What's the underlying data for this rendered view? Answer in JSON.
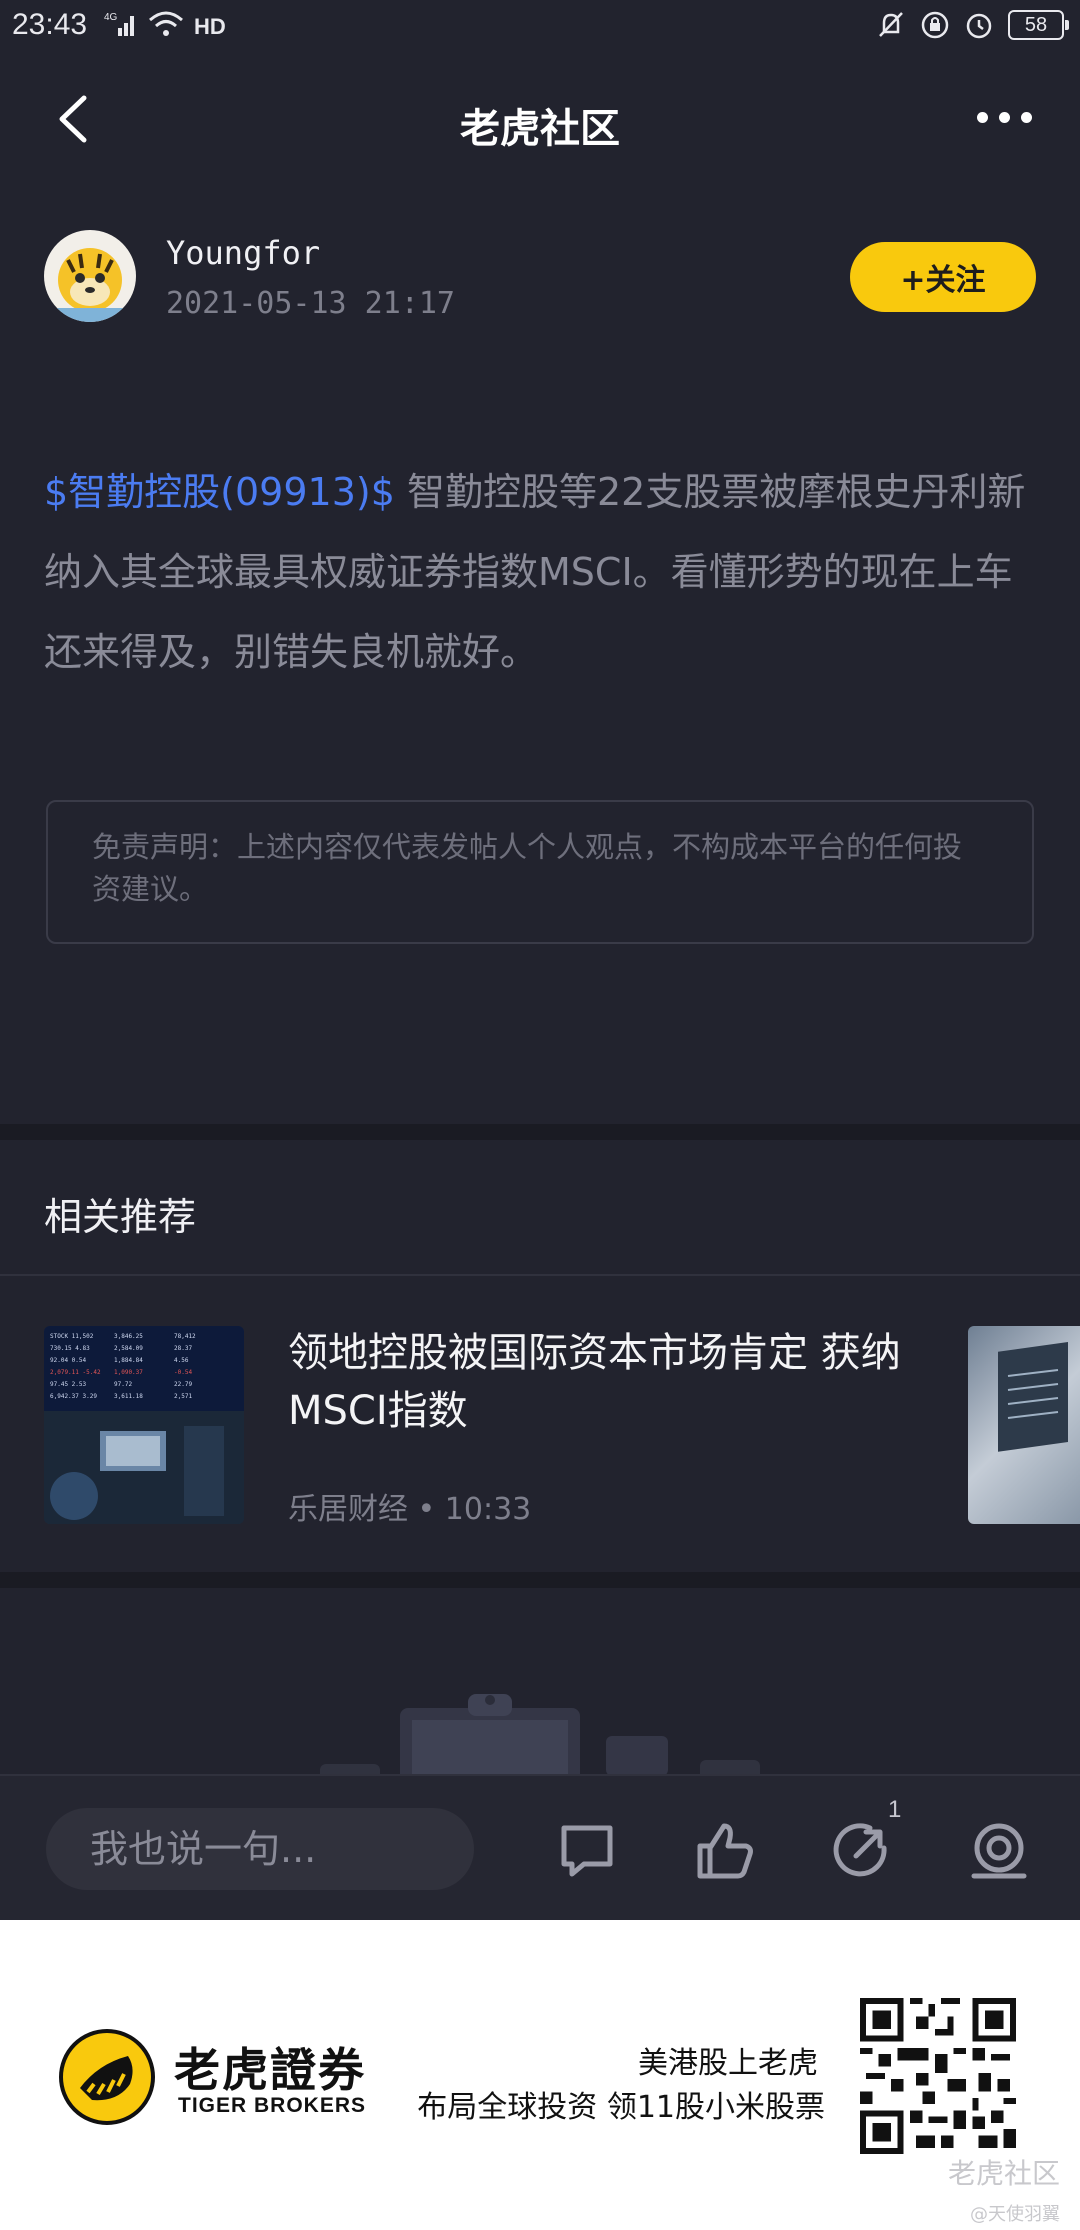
{
  "status_bar": {
    "time": "23:43",
    "network": "4G",
    "battery": "58"
  },
  "nav": {
    "title": "老虎社区"
  },
  "author": {
    "name": "Youngfor",
    "time": "2021-05-13 21:17",
    "follow_label": "+关注"
  },
  "post": {
    "tag": "$智勤控股(09913)$",
    "text": " 智勤控股等22支股票被摩根史丹利新纳入其全球最具权威证券指数MSCI。看懂形势的现在上车还来得及，别错失良机就好。"
  },
  "disclaimer": "免责声明：上述内容仅代表发帖人个人观点，不构成本平台的任何投资建议。",
  "related": {
    "title": "相关推荐",
    "items": [
      {
        "title": "领地控股被国际资本市场肯定 获纳MSCI指数",
        "source": "乐居财经",
        "time": "10:33"
      }
    ]
  },
  "bottom_bar": {
    "placeholder": "我也说一句...",
    "share_count": "1"
  },
  "footer": {
    "brand_cn": "老虎證券",
    "brand_en": "TIGER BROKERS",
    "slogan1": "美港股上老虎",
    "slogan2": "布局全球投资 领11股小米股票",
    "watermark": "老虎社区",
    "watermark_sub": "@天使羽翼"
  },
  "colors": {
    "background": "#22232e",
    "accent": "#f9c90d",
    "link": "#4b7cf2"
  }
}
